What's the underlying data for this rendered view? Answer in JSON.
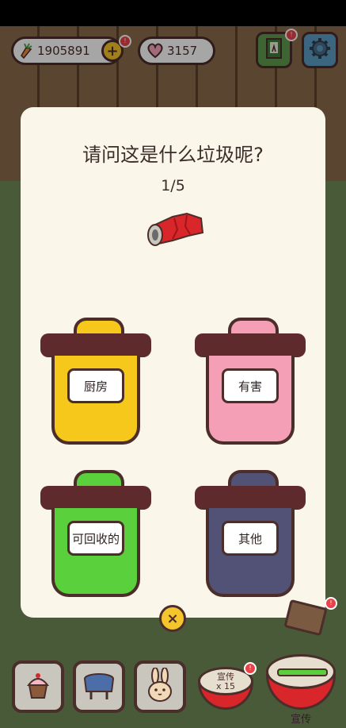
{
  "topbar": {
    "carrots": "1905891",
    "hearts": "3157",
    "add_badge": "!",
    "notebook_badge": "!"
  },
  "quiz": {
    "title": "请问这是什么垃圾呢?",
    "progress": "1/5",
    "item_icon": "crushed-can-icon",
    "bins": [
      {
        "label": "厨房",
        "color": "#f6c81c"
      },
      {
        "label": "有害",
        "color": "#f59fb6"
      },
      {
        "label": "可回收的",
        "color": "#5bd03d"
      },
      {
        "label": "其他",
        "color": "#515275"
      }
    ],
    "close_label": "×"
  },
  "bottom": {
    "promo_label": "宣传",
    "promo_count": "x 15",
    "promo_badge": "!",
    "drum_label": "宣传",
    "side_badge": "!"
  }
}
